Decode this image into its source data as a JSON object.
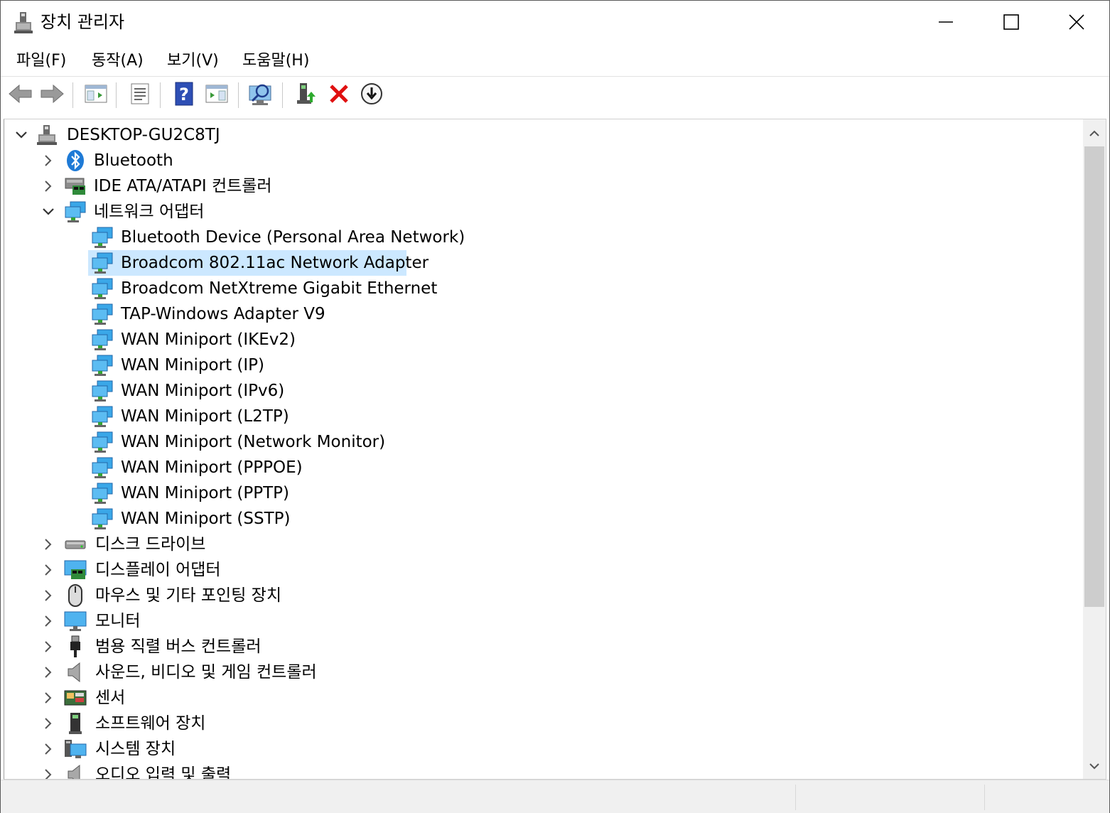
{
  "window": {
    "title": "장치 관리자",
    "controls": {
      "minimize": "minimize-icon",
      "maximize": "maximize-icon",
      "close": "close-icon"
    }
  },
  "menubar": {
    "items": [
      {
        "label": "파일(F)"
      },
      {
        "label": "동작(A)"
      },
      {
        "label": "보기(V)"
      },
      {
        "label": "도움말(H)"
      }
    ]
  },
  "toolbar": {
    "buttons": [
      "back-arrow-icon",
      "forward-arrow-icon",
      "show-hide-console-tree-icon",
      "properties-icon",
      "help-icon",
      "action-pane-icon",
      "scan-hardware-changes-icon",
      "update-driver-icon",
      "uninstall-device-icon",
      "disable-device-icon"
    ]
  },
  "tree": {
    "root": {
      "label": "DESKTOP-GU2C8TJ",
      "expanded": true
    },
    "categories": [
      {
        "label": "Bluetooth",
        "icon": "bluetooth-icon",
        "expanded": false
      },
      {
        "label": "IDE ATA/ATAPI 컨트롤러",
        "icon": "ide-controller-icon",
        "expanded": false
      },
      {
        "label": "네트워크 어댑터",
        "icon": "network-adapter-icon",
        "expanded": true,
        "children": [
          {
            "label": "Bluetooth Device (Personal Area Network)"
          },
          {
            "label": "Broadcom 802.11ac Network Adapter",
            "selected": true
          },
          {
            "label": "Broadcom NetXtreme Gigabit Ethernet"
          },
          {
            "label": "TAP-Windows Adapter V9"
          },
          {
            "label": "WAN Miniport (IKEv2)"
          },
          {
            "label": "WAN Miniport (IP)"
          },
          {
            "label": "WAN Miniport (IPv6)"
          },
          {
            "label": "WAN Miniport (L2TP)"
          },
          {
            "label": "WAN Miniport (Network Monitor)"
          },
          {
            "label": "WAN Miniport (PPPOE)"
          },
          {
            "label": "WAN Miniport (PPTP)"
          },
          {
            "label": "WAN Miniport (SSTP)"
          }
        ]
      },
      {
        "label": "디스크 드라이브",
        "icon": "disk-drive-icon",
        "expanded": false
      },
      {
        "label": "디스플레이 어댑터",
        "icon": "display-adapter-icon",
        "expanded": false
      },
      {
        "label": "마우스 및 기타 포인팅 장치",
        "icon": "mouse-icon",
        "expanded": false
      },
      {
        "label": "모니터",
        "icon": "monitor-icon",
        "expanded": false
      },
      {
        "label": "범용 직렬 버스 컨트롤러",
        "icon": "usb-icon",
        "expanded": false
      },
      {
        "label": "사운드, 비디오 및 게임 컨트롤러",
        "icon": "speaker-icon",
        "expanded": false
      },
      {
        "label": "센서",
        "icon": "sensor-icon",
        "expanded": false
      },
      {
        "label": "소프트웨어 장치",
        "icon": "software-device-icon",
        "expanded": false
      },
      {
        "label": "시스템 장치",
        "icon": "system-device-icon",
        "expanded": false
      },
      {
        "label": "오디오 입력 및 출력",
        "icon": "audio-io-icon",
        "expanded": false
      }
    ]
  },
  "colors": {
    "selection": "#cce8ff",
    "scrollbar_track": "#f0f0f0",
    "scrollbar_thumb": "#cdcdcd",
    "statusbar": "#f0f0f0"
  }
}
